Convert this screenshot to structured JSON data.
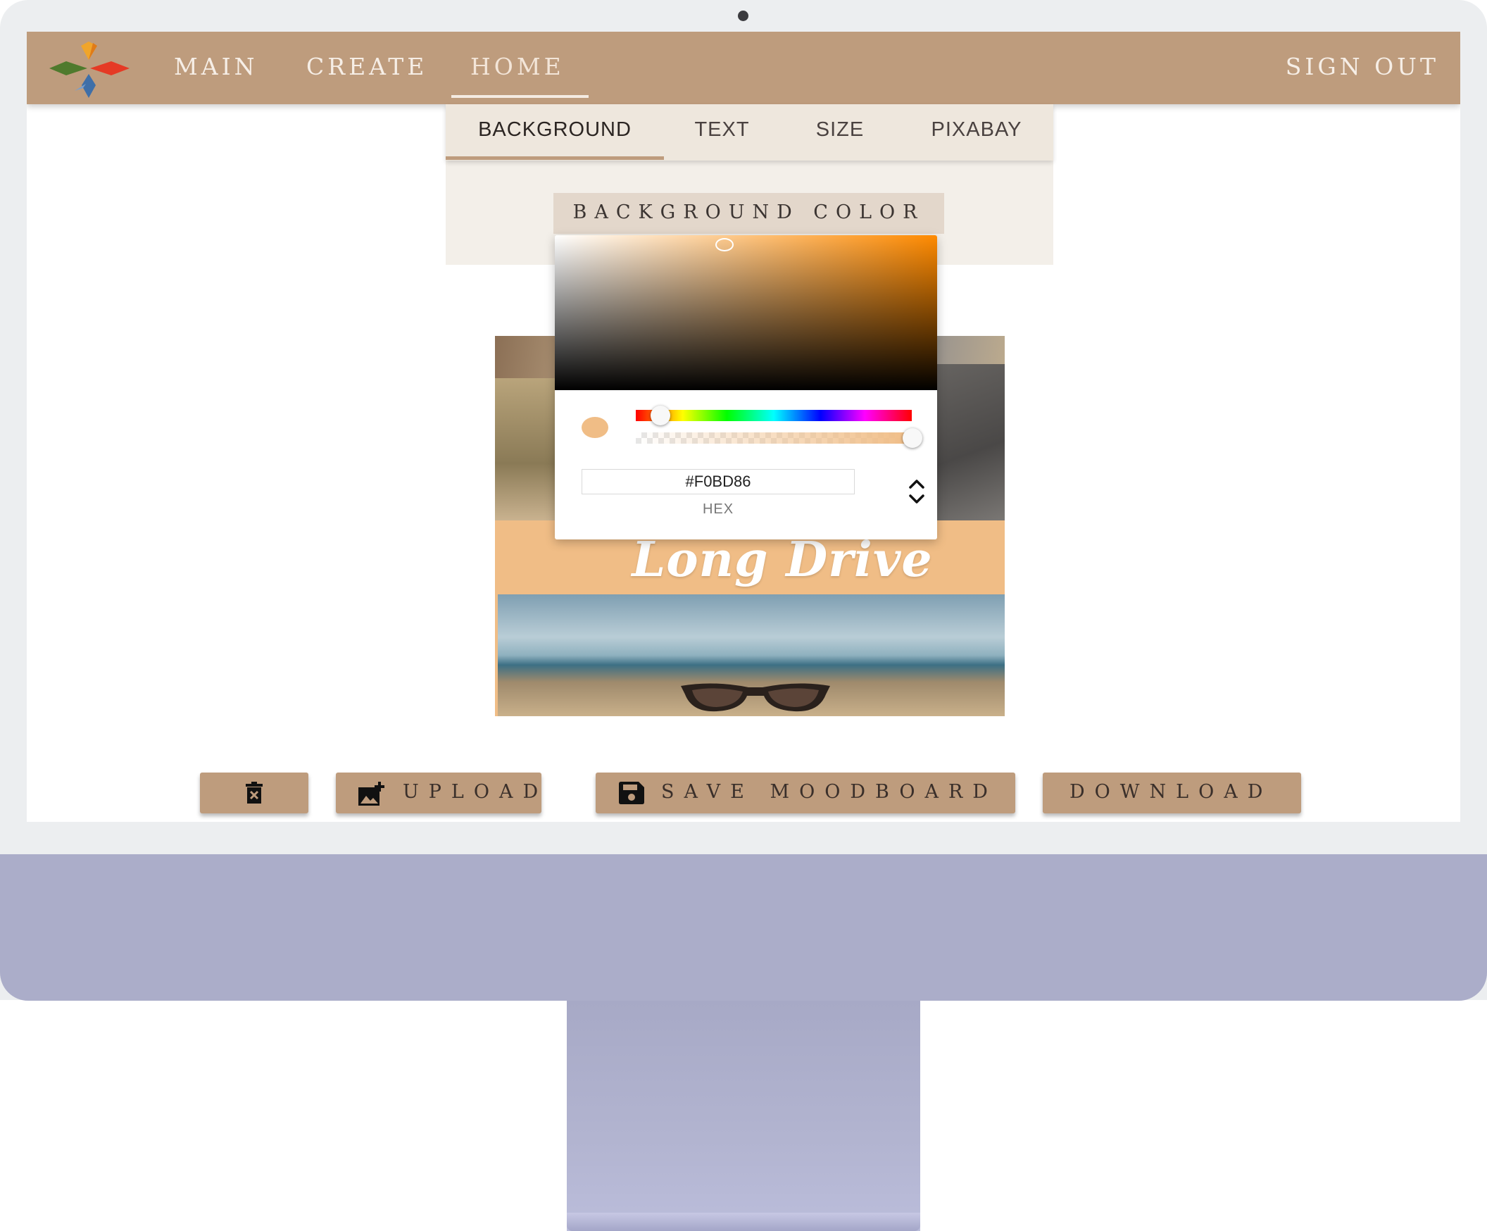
{
  "nav": {
    "links": [
      "MAIN",
      "CREATE",
      "HOME"
    ],
    "active": "HOME",
    "sign_out": "SIGN OUT"
  },
  "tabs": {
    "items": [
      "BACKGROUND",
      "TEXT",
      "SIZE",
      "PIXABAY"
    ],
    "active": "BACKGROUND"
  },
  "background_color_button": "BACKGROUND COLOR",
  "color_picker": {
    "hex_value": "#F0BD86",
    "format_label": "HEX",
    "selected_color": "#F0BD86",
    "alpha_percent": 100
  },
  "moodboard": {
    "caption": "Long Drive",
    "band_color": "#F0BD86"
  },
  "actions": {
    "delete_icon": "trash-icon",
    "upload_label": "UPLOAD",
    "upload_icon": "add-photo-icon",
    "save_label": "SAVE MOODBOARD",
    "save_icon": "floppy-disk-icon",
    "download_label": "DOWNLOAD"
  },
  "colors": {
    "navbar": "#BE9C7D",
    "monitor_chin": "#ABADC9",
    "button": "#BE9C7D"
  }
}
